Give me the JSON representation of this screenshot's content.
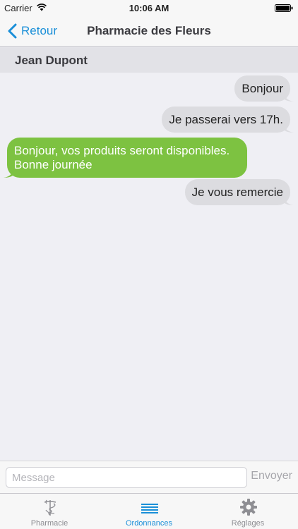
{
  "status": {
    "carrier": "Carrier",
    "time": "10:06 AM"
  },
  "nav": {
    "back_label": "Retour",
    "title": "Pharmacie des Fleurs"
  },
  "contact": {
    "name": "Jean Dupont"
  },
  "messages": [
    {
      "text": "Bonjour",
      "direction": "out"
    },
    {
      "text": "Je passerai vers 17h.",
      "direction": "out"
    },
    {
      "text": "Bonjour, vos produits seront disponibles. Bonne journée",
      "direction": "in"
    },
    {
      "text": "Je vous remercie",
      "direction": "out"
    }
  ],
  "compose": {
    "placeholder": "Message",
    "send_label": "Envoyer"
  },
  "tabs": [
    {
      "label": "Pharmacie",
      "icon": "caduceus-icon",
      "active": false
    },
    {
      "label": "Ordonnances",
      "icon": "list-lines-icon",
      "active": true
    },
    {
      "label": "Réglages",
      "icon": "gear-icon",
      "active": false
    }
  ],
  "colors": {
    "accent": "#1a8fd8",
    "incoming_bubble": "#7dc241",
    "outgoing_bubble": "#dcdce0",
    "background": "#efeff4"
  }
}
